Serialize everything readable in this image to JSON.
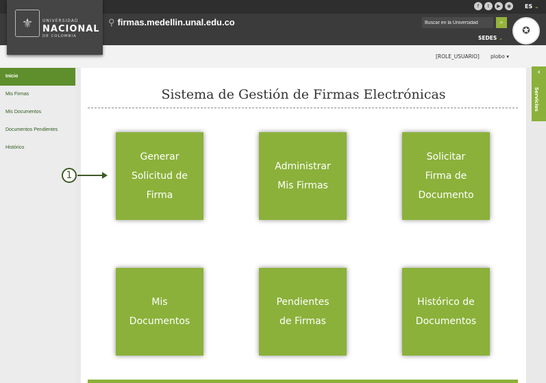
{
  "header": {
    "logo": {
      "line1": "UNIVERSIDAD",
      "line2": "NACIONAL",
      "line3": "DE COLOMBIA"
    },
    "site_url": "firmas.medellin.unal.edu.co",
    "social_icons": [
      "facebook-icon",
      "twitter-icon",
      "youtube-icon",
      "rss-icon"
    ],
    "language": "ES",
    "search": {
      "placeholder": "Buscar en la Universidad"
    },
    "sedes": "SEDES"
  },
  "userbar": {
    "role": "[ROLE_USUARIO]",
    "user": "plobo"
  },
  "sidebar": {
    "items": [
      {
        "label": "Inicio",
        "active": true
      },
      {
        "label": "Mis Firmas",
        "active": false
      },
      {
        "label": "Mis Documentos",
        "active": false
      },
      {
        "label": "Documentos Pendientes",
        "active": false
      },
      {
        "label": "Histórico",
        "active": false
      }
    ]
  },
  "main": {
    "title": "Sistema de Gestión de Firmas Electrónicas",
    "tiles": [
      {
        "label": "Generar\nSolicitud de\nFirma"
      },
      {
        "label": "Administrar\nMis Firmas"
      },
      {
        "label": "Solicitar\nFirma de\nDocumento"
      },
      {
        "label": "Mis\nDocumentos"
      },
      {
        "label": "Pendientes\nde Firmas"
      },
      {
        "label": "Histórico de\nDocumentos"
      }
    ]
  },
  "annotation": {
    "number": "1"
  },
  "servicios": {
    "label": "Servicios"
  },
  "colors": {
    "accent_green": "#8bb13a",
    "sidebar_active": "#5f8e2d",
    "header_dark": "#3b3b3b"
  }
}
